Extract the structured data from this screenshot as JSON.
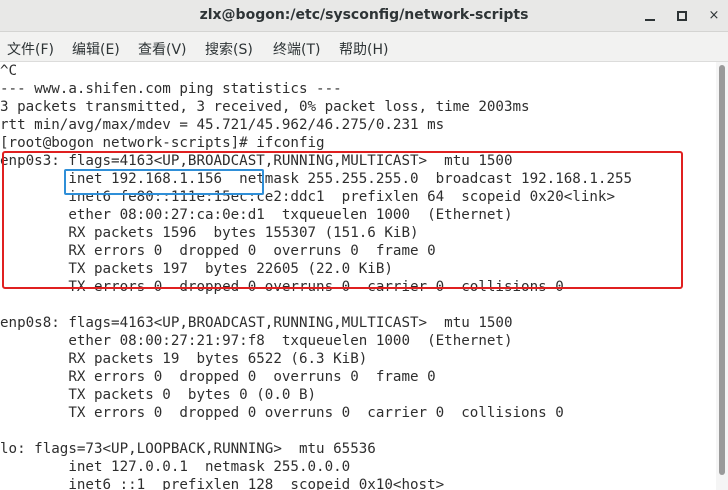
{
  "window": {
    "title": "zlx@bogon:/etc/sysconfig/network-scripts",
    "close_glyph": "×"
  },
  "menu": [
    {
      "label": "文件(F)"
    },
    {
      "label": "编辑(E)"
    },
    {
      "label": "查看(V)"
    },
    {
      "label": "搜索(S)"
    },
    {
      "label": "终端(T)"
    },
    {
      "label": "帮助(H)"
    }
  ],
  "terminal": {
    "lines": [
      "^C",
      "--- www.a.shifen.com ping statistics ---",
      "3 packets transmitted, 3 received, 0% packet loss, time 2003ms",
      "rtt min/avg/max/mdev = 45.721/45.962/46.275/0.231 ms",
      "[root@bogon network-scripts]# ifconfig",
      "enp0s3: flags=4163<UP,BROADCAST,RUNNING,MULTICAST>  mtu 1500",
      "        inet 192.168.1.156  netmask 255.255.255.0  broadcast 192.168.1.255",
      "        inet6 fe80::111e:15ec:ce2:ddc1  prefixlen 64  scopeid 0x20<link>",
      "        ether 08:00:27:ca:0e:d1  txqueuelen 1000  (Ethernet)",
      "        RX packets 1596  bytes 155307 (151.6 KiB)",
      "        RX errors 0  dropped 0  overruns 0  frame 0",
      "        TX packets 197  bytes 22605 (22.0 KiB)",
      "        TX errors 0  dropped 0 overruns 0  carrier 0  collisions 0",
      "",
      "enp0s8: flags=4163<UP,BROADCAST,RUNNING,MULTICAST>  mtu 1500",
      "        ether 08:00:27:21:97:f8  txqueuelen 1000  (Ethernet)",
      "        RX packets 19  bytes 6522 (6.3 KiB)",
      "        RX errors 0  dropped 0  overruns 0  frame 0",
      "        TX packets 0  bytes 0 (0.0 B)",
      "        TX errors 0  dropped 0 overruns 0  carrier 0  collisions 0",
      "",
      "lo: flags=73<UP,LOOPBACK,RUNNING>  mtu 65536",
      "        inet 127.0.0.1  netmask 255.0.0.0",
      "        inet6 ::1  prefixlen 128  scopeid 0x10<host>"
    ]
  },
  "highlights": {
    "interface_block_color": "#e02020",
    "ip_address_color": "#2f8fd8"
  }
}
